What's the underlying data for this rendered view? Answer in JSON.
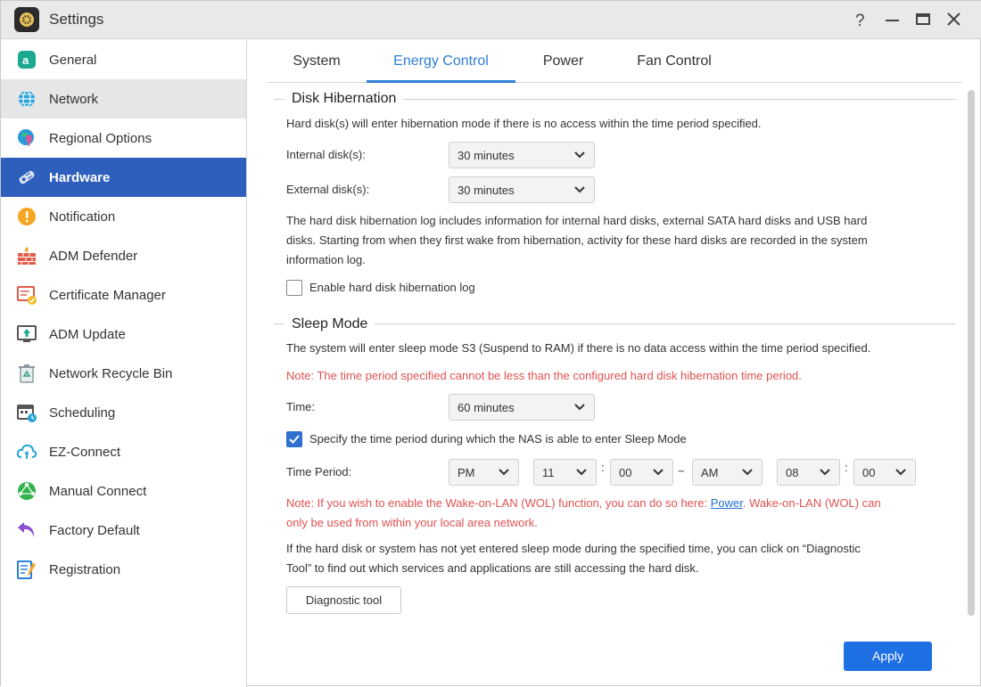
{
  "window": {
    "title": "Settings"
  },
  "titlebar": {
    "help_icon": "help-icon",
    "minimize_icon": "minimize-icon",
    "maximize_icon": "maximize-icon",
    "close_icon": "close-icon"
  },
  "sidebar": {
    "items": [
      {
        "label": "General",
        "icon": "general-icon",
        "state": ""
      },
      {
        "label": "Network",
        "icon": "network-globe-icon",
        "state": "hover"
      },
      {
        "label": "Regional Options",
        "icon": "regional-globe-pin-icon",
        "state": ""
      },
      {
        "label": "Hardware",
        "icon": "hardware-icon",
        "state": "active"
      },
      {
        "label": "Notification",
        "icon": "notification-icon",
        "state": ""
      },
      {
        "label": "ADM Defender",
        "icon": "firewall-icon",
        "state": ""
      },
      {
        "label": "Certificate Manager",
        "icon": "certificate-icon",
        "state": ""
      },
      {
        "label": "ADM Update",
        "icon": "update-icon",
        "state": ""
      },
      {
        "label": "Network Recycle Bin",
        "icon": "recycle-bin-icon",
        "state": ""
      },
      {
        "label": "Scheduling",
        "icon": "scheduling-icon",
        "state": ""
      },
      {
        "label": "EZ-Connect",
        "icon": "cloud-upload-icon",
        "state": ""
      },
      {
        "label": "Manual Connect",
        "icon": "manual-connect-icon",
        "state": ""
      },
      {
        "label": "Factory Default",
        "icon": "undo-arrow-icon",
        "state": ""
      },
      {
        "label": "Registration",
        "icon": "registration-icon",
        "state": ""
      }
    ]
  },
  "tabs": [
    {
      "label": "System",
      "active": false
    },
    {
      "label": "Energy Control",
      "active": true
    },
    {
      "label": "Power",
      "active": false
    },
    {
      "label": "Fan Control",
      "active": false
    }
  ],
  "disk_hibernation": {
    "title": "Disk Hibernation",
    "description": "Hard disk(s) will enter hibernation mode if there is no access within the time period specified.",
    "internal_label": "Internal disk(s):",
    "internal_value": "30 minutes",
    "external_label": "External disk(s):",
    "external_value": "30 minutes",
    "log_info_line1": "The hard disk hibernation log includes information for internal hard disks, external SATA hard disks and USB hard",
    "log_info_line2": "disks. Starting from when they first wake from hibernation, activity for these hard disks are recorded in the system",
    "log_info_line3": "information log.",
    "enable_log_label": "Enable hard disk hibernation log",
    "enable_log_checked": false
  },
  "sleep_mode": {
    "title": "Sleep Mode",
    "description": "The system will enter sleep mode S3 (Suspend to RAM) if there is no data access within the time period specified.",
    "note": "Note: The time period specified cannot be less than the configured hard disk hibernation time period.",
    "time_label": "Time:",
    "time_value": "60 minutes",
    "specify_label": "Specify the time period during which the NAS is able to enter Sleep Mode",
    "specify_checked": true,
    "period_label": "Time Period:",
    "start_ampm": "PM",
    "start_hour": "11",
    "start_minute": "00",
    "separator_colon": ":",
    "separator_tilde": "~",
    "end_ampm": "AM",
    "end_hour": "08",
    "end_minute": "00",
    "wol_note_prefix": "Note: If you wish to enable the Wake-on-LAN (WOL) function, you can do so here:",
    "wol_link": "Power",
    "wol_note_suffix": ". Wake-on-LAN (WOL) can",
    "wol_note_line2": "only be used from within your local area network.",
    "diag_info_line1": "If the hard disk or system has not yet entered sleep mode during the specified time, you can click on “Diagnostic",
    "diag_info_line2": "Tool” to find out which services and applications are still accessing the hard disk.",
    "diag_button": "Diagnostic tool"
  },
  "footer": {
    "apply": "Apply"
  },
  "colors": {
    "accent": "#2f7fd6",
    "sidebar_active": "#2f5fbd",
    "note_red": "#e05252",
    "apply_button": "#1f6fe5"
  }
}
